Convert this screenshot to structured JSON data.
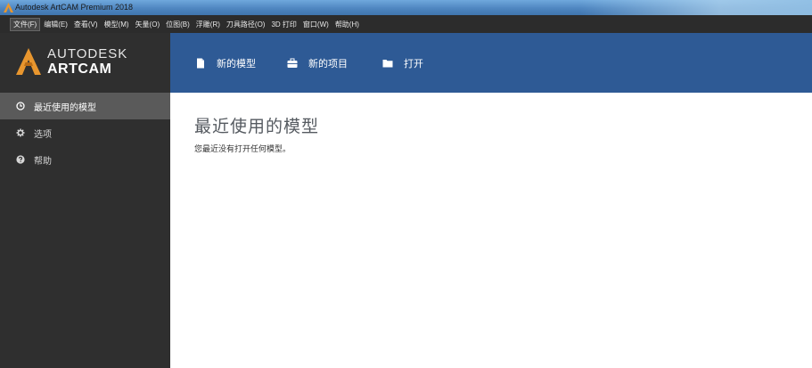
{
  "window": {
    "title": "Autodesk ArtCAM Premium 2018"
  },
  "menubar": {
    "items": [
      {
        "label": "文件(F)",
        "active": true
      },
      {
        "label": "编辑(E)",
        "active": false
      },
      {
        "label": "查看(V)",
        "active": false
      },
      {
        "label": "模型(M)",
        "active": false
      },
      {
        "label": "矢量(O)",
        "active": false
      },
      {
        "label": "位图(B)",
        "active": false
      },
      {
        "label": "浮雕(R)",
        "active": false
      },
      {
        "label": "刀具路径(O)",
        "active": false
      },
      {
        "label": "3D 打印",
        "active": false
      },
      {
        "label": "窗口(W)",
        "active": false
      },
      {
        "label": "帮助(H)",
        "active": false
      }
    ]
  },
  "logo": {
    "brand": "AUTODESK",
    "product": "ARTCAM"
  },
  "sidebar": {
    "items": [
      {
        "label": "最近使用的模型",
        "icon": "clock-icon",
        "active": true
      },
      {
        "label": "选项",
        "icon": "gear-icon",
        "active": false
      },
      {
        "label": "帮助",
        "icon": "help-icon",
        "active": false
      }
    ]
  },
  "header": {
    "new_model_label": "新的模型",
    "new_project_label": "新的项目",
    "open_label": "打开"
  },
  "main": {
    "title": "最近使用的模型",
    "empty_message": "您最近没有打开任何模型。"
  },
  "colors": {
    "header_blue": "#2e5a95",
    "sidebar_dark": "#2f2f2f",
    "sidebar_active": "#5a5a5a",
    "logo_orange": "#e8962e"
  }
}
